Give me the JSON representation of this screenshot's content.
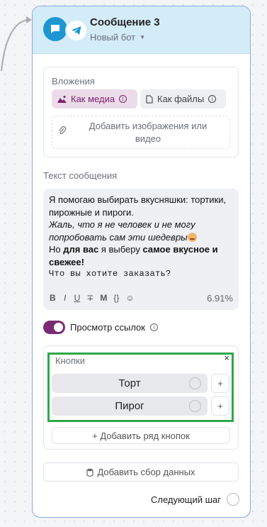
{
  "node": {
    "title": "Сообщение 3",
    "bot_name": "Новый бот"
  },
  "attachments": {
    "label": "Вложения",
    "as_media_label": "Как медиа",
    "as_files_label": "Как файлы",
    "add_media_label": "Добавить изображения или видео"
  },
  "message": {
    "label": "Текст сообщения",
    "line1": "Я помогаю выбирать вкусняшки: тортики, пирожные и пироги.",
    "line2": "Жаль, что я не человек и не могу попробовать сам эти шедевры",
    "line3_pre": "Но ",
    "line3_bold1": "для вас",
    "line3_mid": " я выберу ",
    "line3_bold2": "самое вкусное и свежее!",
    "line4": "Что вы хотите заказать?",
    "toolbar": [
      "B",
      "I",
      "U",
      "∓",
      "M",
      "{}",
      "☺"
    ],
    "usage": "6.91%"
  },
  "link_preview": {
    "label": "Просмотр ссылок",
    "enabled": true
  },
  "buttons": {
    "label": "Кнопки",
    "close": "×",
    "rows": [
      {
        "label": "Торт",
        "plus": "+"
      },
      {
        "label": "Пирог",
        "plus": "+"
      }
    ],
    "add_row_label": "+ Добавить ряд кнопок"
  },
  "collect_data_label": "Добавить сбор данных",
  "next_step_label": "Следующий шаг",
  "colors": {
    "header_bg": "#d4ecf8",
    "accent_purple": "#7a2b74",
    "highlight_green": "#2ea84a",
    "telegram_blue": "#1d96d2"
  }
}
